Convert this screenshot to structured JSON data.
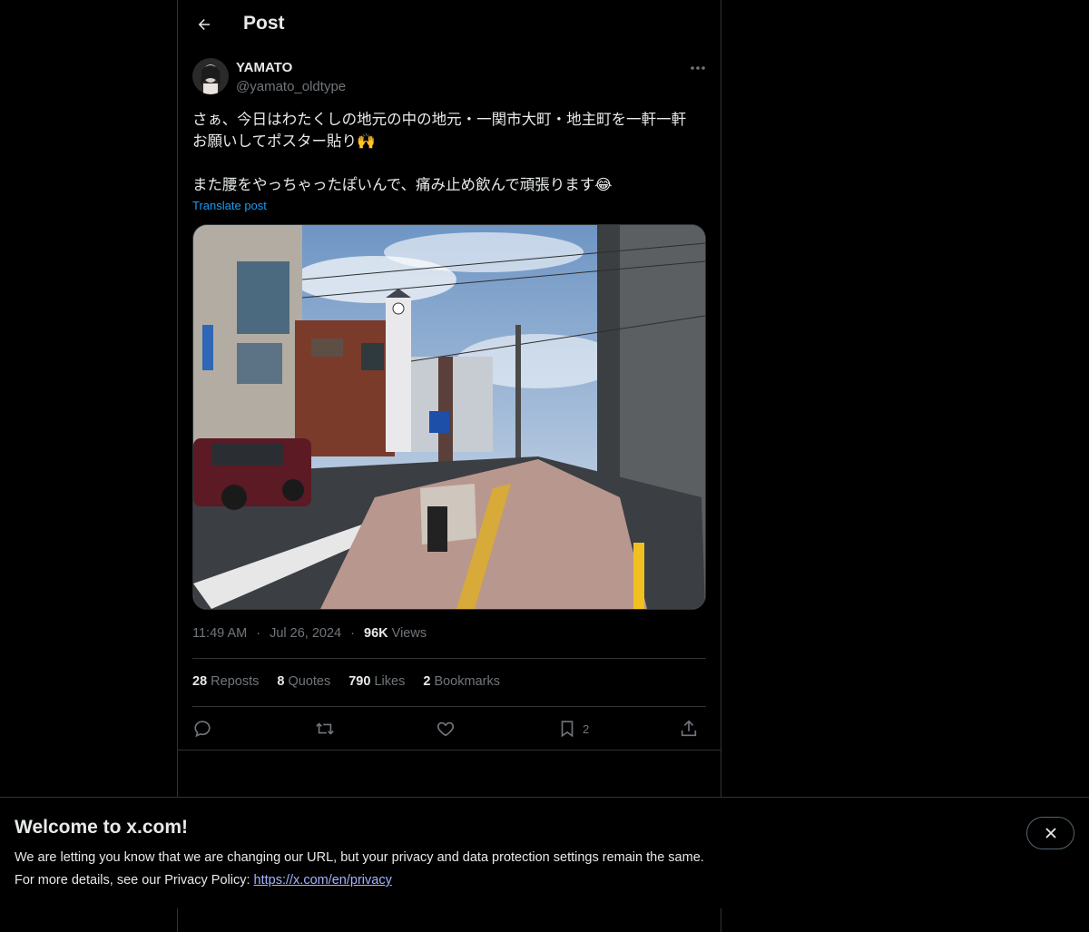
{
  "header": {
    "title": "Post"
  },
  "author": {
    "name": "YAMATO",
    "handle": "@yamato_oldtype"
  },
  "tweet": {
    "line1": "さぁ、今日はわたくしの地元の中の地元・一関市大町・地主町を一軒一軒",
    "line2": "お願いしてポスター貼り🙌",
    "line3": "また腰をやっちゃったぽいんで、痛み止め飲んで頑張ります😂",
    "translate_label": "Translate post"
  },
  "meta": {
    "time": "11:49 AM",
    "separator": "·",
    "date": "Jul 26, 2024",
    "views_count": "96K",
    "views_label": "Views"
  },
  "stats": [
    {
      "count": "28",
      "label": "Reposts"
    },
    {
      "count": "8",
      "label": "Quotes"
    },
    {
      "count": "790",
      "label": "Likes"
    },
    {
      "count": "2",
      "label": "Bookmarks"
    }
  ],
  "actions": {
    "reply": {
      "icon": "reply-icon"
    },
    "repost": {
      "icon": "repost-icon"
    },
    "like": {
      "icon": "heart-icon"
    },
    "bookmark": {
      "icon": "bookmark-icon",
      "count": "2"
    },
    "share": {
      "icon": "share-icon"
    }
  },
  "banner": {
    "title": "Welcome to x.com!",
    "line1": "We are letting you know that we are changing our URL, but your privacy and data protection settings remain the same.",
    "line2_prefix": "For more details, see our Privacy Policy: ",
    "link_text": "https://x.com/en/privacy"
  },
  "colors": {
    "background": "#000000",
    "text": "#e7e9ea",
    "secondary_text": "#71767b",
    "accent": "#1d9bf0",
    "border": "#2f3336",
    "link": "#a4b3ff"
  }
}
